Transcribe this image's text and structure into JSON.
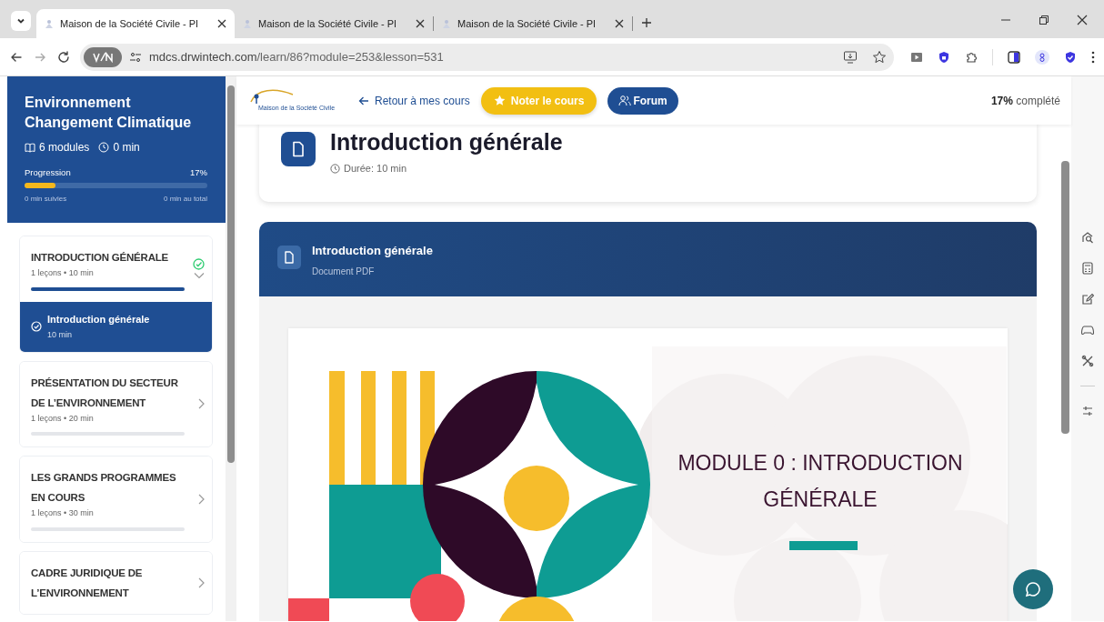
{
  "browser": {
    "tabs": [
      {
        "title": "Maison de la Société Civile - Pl",
        "selected": true
      },
      {
        "title": "Maison de la Société Civile - Pl",
        "selected": false
      },
      {
        "title": "Maison de la Société Civile - Pl",
        "selected": false
      }
    ],
    "url_host": "mdcs.drwintech.com",
    "url_path": "/learn/86?module=253&lesson=531"
  },
  "course": {
    "title": "Environnement Changement Climatique",
    "modules": "6 modules",
    "duration": "0 min",
    "progress_label": "Progression",
    "progress_value": "17%",
    "level": 0.17,
    "followed": "0 min suivies",
    "total": "0 min au total"
  },
  "modules": [
    {
      "title": "INTRODUCTION GÉNÉRALE",
      "meta": "1 leçons • 10 min",
      "completed": true,
      "expanded": true,
      "level": 1,
      "lessons": [
        {
          "title": "Introduction générale",
          "duration": "10 min",
          "selected": true
        }
      ]
    },
    {
      "title": "PRÉSENTATION DU SECTEUR DE L’ENVIRONNEMENT",
      "meta": "1 leçons • 20 min",
      "completed": false,
      "expanded": false,
      "level": 0
    },
    {
      "title": "LES GRANDS PROGRAMMES EN COURS",
      "meta": "1 leçons • 30 min",
      "completed": false,
      "expanded": false,
      "level": 0
    },
    {
      "title": "CADRE JURIDIQUE DE L’ENVIRONNEMENT",
      "completed": false,
      "expanded": false
    }
  ],
  "topbar": {
    "logo_text": "Maison de la Société Civile",
    "back": "Retour à mes cours",
    "rate": "Noter le cours",
    "forum": "Forum",
    "completion": "**17%** complété"
  },
  "lesson": {
    "title": "Introduction générale",
    "duration": "Durée: 10 min"
  },
  "document": {
    "title": "Introduction générale",
    "type": "Document PDF",
    "slide_title_lines": [
      "MODULE 0 : INTRODUCTION",
      "GÉNÉRALE"
    ]
  }
}
